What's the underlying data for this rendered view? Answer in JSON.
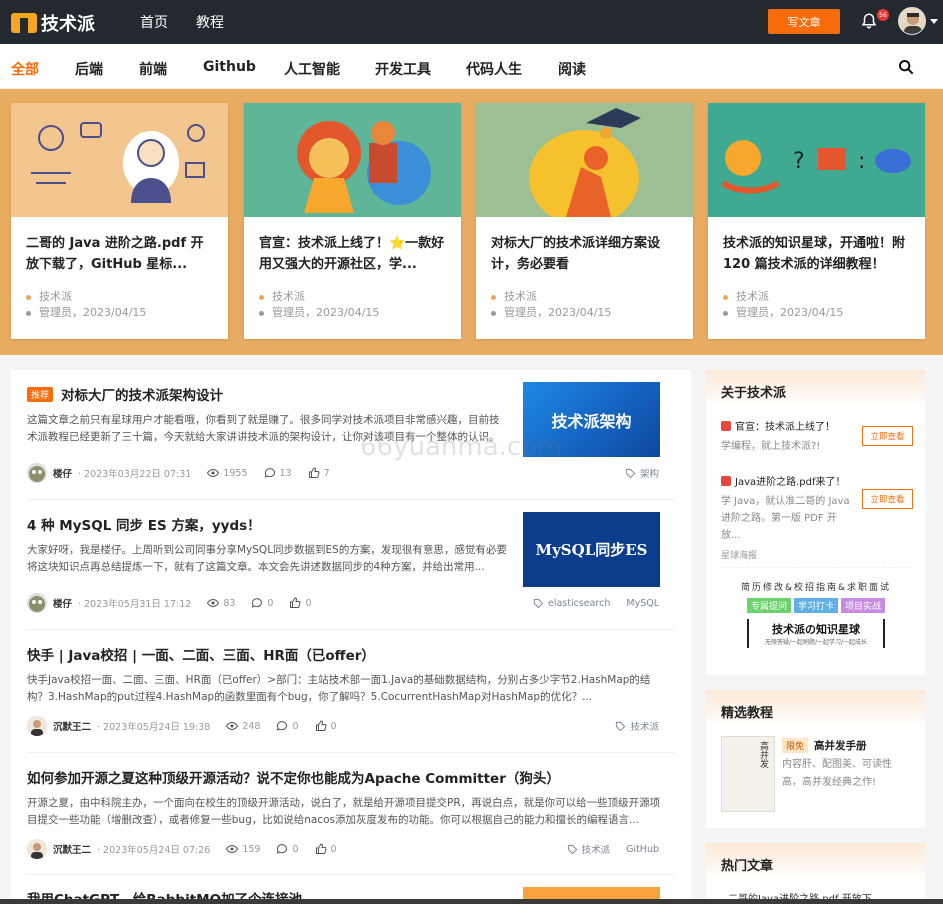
{
  "header": {
    "logo_text": "技术派",
    "nav": [
      "首页",
      "教程"
    ],
    "write_button": "写文章",
    "notification_count": "56"
  },
  "categories": [
    "全部",
    "后端",
    "前端",
    "Github",
    "人工智能",
    "开发工具",
    "代码人生",
    "阅读"
  ],
  "featured": [
    {
      "title": "二哥的 Java 进阶之路.pdf 开放下载了，GitHub 星标...",
      "site": "技术派",
      "meta": "管理员，2023/04/15"
    },
    {
      "title": "官宣：技术派上线了！⭐一款好用又强大的开源社区，学...",
      "site": "技术派",
      "meta": "管理员，2023/04/15"
    },
    {
      "title": "对标大厂的技术派详细方案设计，务必要看",
      "site": "技术派",
      "meta": "管理员，2023/04/15"
    },
    {
      "title": "技术派的知识星球，开通啦！附 120 篇技术派的详细教程！",
      "site": "技术派",
      "meta": "管理员，2023/04/15"
    }
  ],
  "articles": [
    {
      "tag": "推荐",
      "title": "对标大厂的技术派架构设计",
      "summary": "这篇文章之前只有星球用户才能看哦，你看到了就是赚了。很多同学对技术派项目非常感兴趣，目前技术派教程已经更新了三十篇，今天就给大家讲讲技术派的架构设计，让你对该项目有一个整体的认识。",
      "thumb": "技术派架构",
      "author": "楼仔",
      "date": "· 2023年03月22日 07:31",
      "views": "1955",
      "comments": "13",
      "likes": "7",
      "tags": [
        "架构"
      ]
    },
    {
      "tag": "",
      "title": "4 种 MySQL 同步 ES 方案，yyds！",
      "summary": "大家好呀，我是楼仔。上周听到公司同事分享MySQL同步数据到ES的方案，发现很有意思，感觉有必要将这块知识点再总结提炼一下，就有了这篇文章。本文会先讲述数据同步的4种方案，并给出常用...",
      "thumb": "MySQL同步ES",
      "author": "楼仔",
      "date": "· 2023年05月31日 17:12",
      "views": "83",
      "comments": "0",
      "likes": "0",
      "tags": [
        "elasticsearch",
        "MySQL"
      ]
    },
    {
      "tag": "",
      "title": "快手 | Java校招 | 一面、二面、三面、HR面（已offer）",
      "summary": "快手Java校招一面、二面、三面、HR面（已offer）>部门：主站技术部一面1.Java的基础数据结构，分别占多少字节2.HashMap的结构？3.HashMap的put过程4.HashMap的函数里面有个bug，你了解吗？5.CocurrentHashMap对HashMap的优化？...",
      "thumb": "",
      "author": "沉默王二",
      "date": "· 2023年05月24日 19:38",
      "views": "248",
      "comments": "0",
      "likes": "0",
      "tags": [
        "技术派"
      ]
    },
    {
      "tag": "",
      "title": "如何参加开源之夏这种顶级开源活动？说不定你也能成为Apache Committer（狗头）",
      "summary": "开源之夏，由中科院主办，一个面向在校生的顶级开源活动，说白了，就是给开源项目提交PR，再说白点，就是你可以给一些顶级开源项目提交一些功能（增删改查），或者修复一些bug，比如说给nacos添加灰度发布的功能。你可以根据自己的能力和擅长的编程语言...",
      "thumb": "",
      "author": "沉默王二",
      "date": "· 2023年05月24日 07:26",
      "views": "159",
      "comments": "0",
      "likes": "0",
      "tags": [
        "技术派",
        "GitHub"
      ]
    },
    {
      "tag": "",
      "title": "我用ChatGPT，给RabbitMQ加了个连接池",
      "summary": "",
      "thumb": "",
      "author": "",
      "date": "",
      "views": "",
      "comments": "",
      "likes": "",
      "tags": []
    }
  ],
  "sidebar": {
    "about": {
      "title": "关于技术派",
      "items": [
        {
          "title": "官宣：技术派上线了！",
          "desc": "学编程，就上技术派?!",
          "button": "立即查看"
        },
        {
          "title": "Java进阶之路.pdf来了！",
          "desc": "学 Java，就认准二哥的 Java 进阶之路。第一版 PDF 开放...",
          "button": "立即查看"
        }
      ],
      "poster_label": "星球海报",
      "poster_line1": "简历修改&校招指南&求职面试",
      "poster_tags": [
        "专属提问",
        "学习打卡",
        "项目实战"
      ],
      "poster_title": "技术派の知识星球",
      "poster_sub": "无限答疑/一起刷题/一起学习/一起成长"
    },
    "tutorial": {
      "title": "精选教程",
      "badge": "限免",
      "name": "高并发手册",
      "cover": "高并发",
      "desc": "内容肝、配图美、可读性高，高并发经典之作!"
    },
    "hot": {
      "title": "热门文章",
      "first": "二哥的Java进阶之路.pdf 开放下..."
    }
  },
  "watermark": "66yuanma.com",
  "colors": {
    "accent": "#f96c0b",
    "topbar": "#24292f",
    "banner": "#e9ad62"
  }
}
